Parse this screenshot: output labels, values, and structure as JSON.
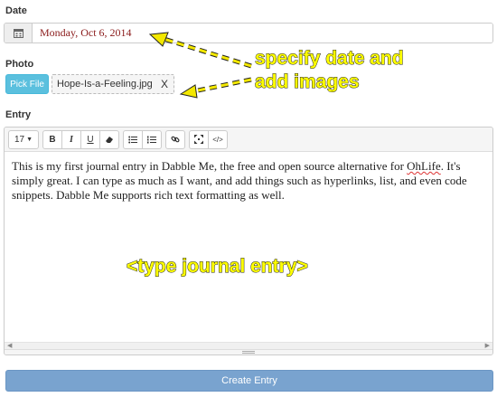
{
  "date": {
    "label": "Date",
    "value": "Monday, Oct 6, 2014",
    "icon": "calendar-icon"
  },
  "photo": {
    "label": "Photo",
    "pick_button": "Pick File",
    "file_name": "Hope-Is-a-Feeling.jpg",
    "remove": "X"
  },
  "entry": {
    "label": "Entry",
    "font_size": "17",
    "toolbar": {
      "bold": "B",
      "italic": "I",
      "underline": "U",
      "eraser": "eraser-icon",
      "bullet_list": "bullet-list-icon",
      "numbered_list": "numbered-list-icon",
      "link": "link-icon",
      "fullscreen": "fullscreen-icon",
      "code_view": "</>"
    },
    "text_before": "This is my first journal entry in Dabble Me, the free and open source alternative for ",
    "text_link": "OhLife",
    "text_after": ". It's simply great. I can type as much as I want, and add things such as hyperlinks, list, and even code snippets. Dabble Me supports rich text formatting as well."
  },
  "submit_label": "Create Entry",
  "annotations": {
    "line1": "specify date and",
    "line2": "add images",
    "entry": "<type journal entry>",
    "color": "#ffff00"
  }
}
